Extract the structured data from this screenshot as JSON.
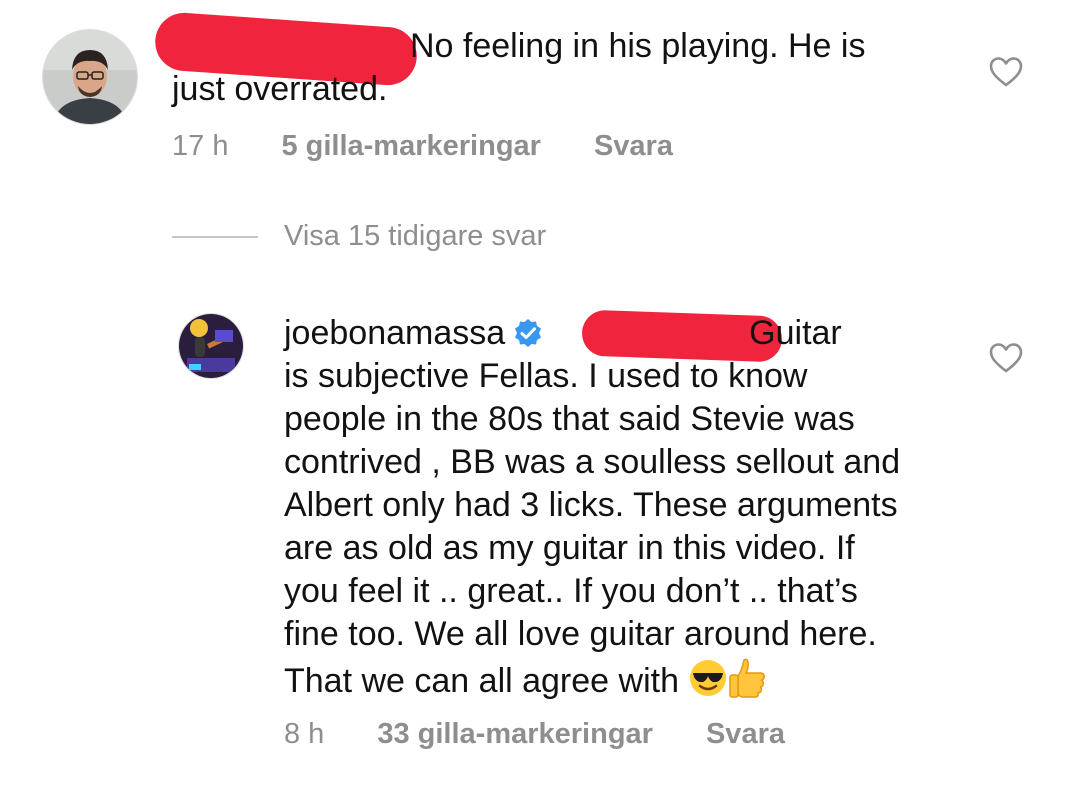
{
  "comment1": {
    "text_line1": "No feeling in his playing. He is",
    "text_line2": "just overrated.",
    "time": "17 h",
    "likes": "5 gilla-markeringar",
    "reply": "Svara",
    "icons": {
      "avatar": "user-avatar-icon",
      "heart": "heart-outline-icon"
    }
  },
  "view_replies": {
    "label": "Visa 15 tidigare svar"
  },
  "comment2": {
    "username": "joebonamassa",
    "text_first": "Guitar",
    "lines": [
      "is subjective Fellas. I used to know",
      "people in the 80s that said Stevie was",
      "contrived , BB was a soulless sellout and",
      "Albert only had 3 licks. These arguments",
      "are as old as my guitar in this video.  If",
      "you feel it .. great.. If you don’t .. that’s",
      "fine too. We all love guitar around here."
    ],
    "last_line": "That we can all agree with",
    "time": "8 h",
    "likes": "33 gilla-markeringar",
    "reply": "Svara",
    "icons": {
      "verified": "verified-badge-icon",
      "emoji1": "sunglasses-emoji-icon",
      "emoji2": "thumbs-up-emoji-icon",
      "heart": "heart-outline-icon"
    }
  },
  "colors": {
    "text": "#121212",
    "secondary": "#8e8e8e",
    "verified": "#3897f0",
    "redaction": "#f0243c"
  }
}
